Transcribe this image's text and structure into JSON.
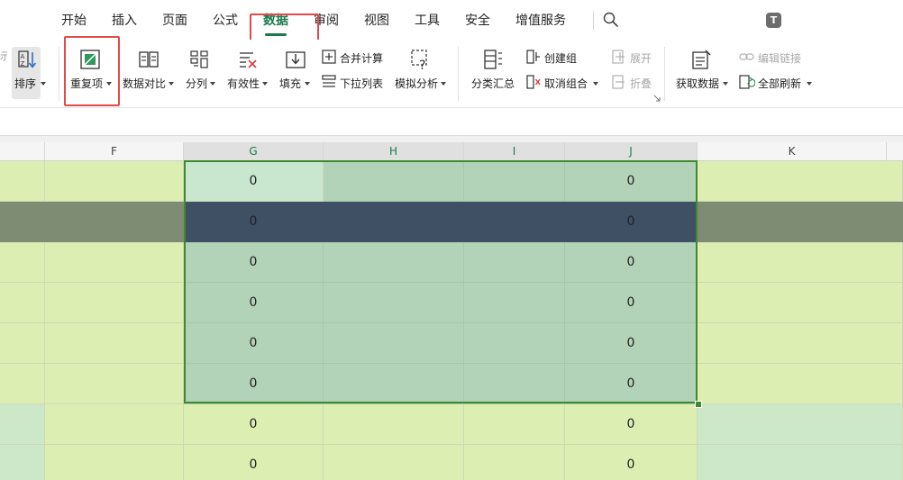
{
  "menu": {
    "tabs": [
      "开始",
      "插入",
      "页面",
      "公式",
      "数据",
      "审阅",
      "视图",
      "工具",
      "安全",
      "增值服务"
    ],
    "active_tab": "数据",
    "avatar_letter": "T"
  },
  "ribbon": {
    "sort": "排序",
    "duplicates": "重复项",
    "data_compare": "数据对比",
    "split": "分列",
    "validity": "有效性",
    "fill": "填充",
    "merge_calc": "合并计算",
    "dropdown_list": "下拉列表",
    "simulation": "模拟分析",
    "subtotal": "分类汇总",
    "create_group": "创建组",
    "ungroup": "取消组合",
    "expand": "展开",
    "collapse": "折叠",
    "get_data": "获取数据",
    "edit_links": "编辑链接",
    "refresh_all": "全部刷新"
  },
  "sheet": {
    "columns": [
      "F",
      "G",
      "H",
      "I",
      "J",
      "K"
    ],
    "rows": [
      {
        "F": "",
        "G": "0",
        "H": "",
        "I": "",
        "J": "0",
        "K": ""
      },
      {
        "F": "",
        "G": "0",
        "H": "",
        "I": "",
        "J": "0",
        "K": ""
      },
      {
        "F": "",
        "G": "0",
        "H": "",
        "I": "",
        "J": "0",
        "K": ""
      },
      {
        "F": "",
        "G": "0",
        "H": "",
        "I": "",
        "J": "0",
        "K": ""
      },
      {
        "F": "",
        "G": "0",
        "H": "",
        "I": "",
        "J": "0",
        "K": ""
      },
      {
        "F": "",
        "G": "0",
        "H": "",
        "I": "",
        "J": "0",
        "K": ""
      },
      {
        "F": "",
        "G": "0",
        "H": "",
        "I": "",
        "J": "0",
        "K": ""
      },
      {
        "F": "",
        "G": "0",
        "H": "",
        "I": "",
        "J": "0",
        "K": ""
      }
    ]
  },
  "colors": {
    "accent": "#1a7a4c",
    "highlight_box": "#e14a4a",
    "selection_border": "#3e8a2e",
    "cell_light": "#ddeeb2",
    "cell_selected": "#b3d3b8",
    "row_dark": "#3f4f64"
  }
}
